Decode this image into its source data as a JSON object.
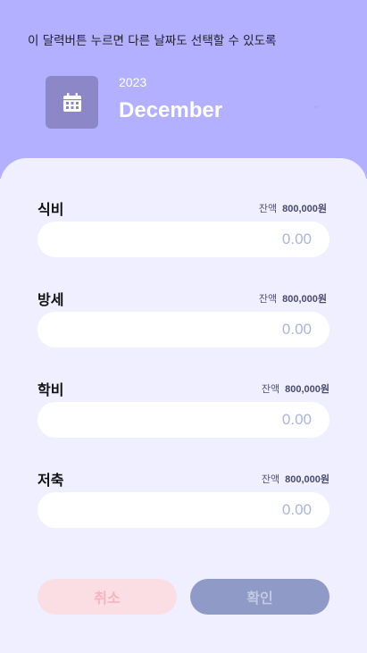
{
  "header": {
    "notice": "이 달력버튼 누르면 다른 날짜도 선택할 수 있도록",
    "year": "2023",
    "month": "December",
    "calendar_icon": "calendar-icon",
    "dropdown_icon": "chevron-down-icon"
  },
  "categories": [
    {
      "label": "식비",
      "balance_label": "잔액",
      "balance_value": "800,000원",
      "amount": "0.00"
    },
    {
      "label": "방세",
      "balance_label": "잔액",
      "balance_value": "800,000원",
      "amount": "0.00"
    },
    {
      "label": "학비",
      "balance_label": "잔액",
      "balance_value": "800,000원",
      "amount": "0.00"
    },
    {
      "label": "저축",
      "balance_label": "잔액",
      "balance_value": "800,000원",
      "amount": "0.00"
    }
  ],
  "buttons": {
    "cancel_label": "취소",
    "confirm_label": "확인"
  },
  "colors": {
    "header_bg": "#b2b0ff",
    "sheet_bg": "#f0efff",
    "cancel_bg": "#fadee4",
    "confirm_bg": "#8f9ac6"
  }
}
